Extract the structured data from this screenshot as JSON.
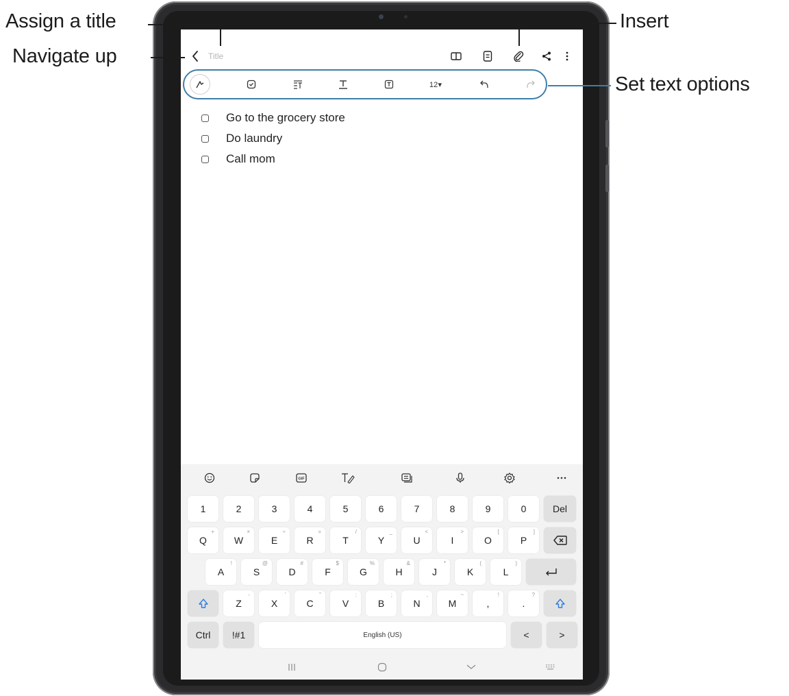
{
  "callouts": {
    "assign_title": "Assign a title",
    "navigate_up": "Navigate up",
    "insert": "Insert",
    "set_text_options": "Set text options"
  },
  "app_bar": {
    "back_icon": "chevron-left-icon",
    "title_placeholder": "Title",
    "actions": [
      {
        "name": "reading-mode",
        "icon": "book-icon"
      },
      {
        "name": "page-view",
        "icon": "document-icon"
      },
      {
        "name": "insert",
        "icon": "paperclip-icon"
      },
      {
        "name": "share",
        "icon": "share-icon"
      },
      {
        "name": "more-options",
        "icon": "more-vertical-icon"
      }
    ]
  },
  "text_toolbar": {
    "items": [
      "pen-icon",
      "checkbox-icon",
      "paragraph-style-icon",
      "text-style-icon",
      "text-box-icon",
      "font-size",
      "undo-icon",
      "redo-icon"
    ],
    "font_size_label": "12▾"
  },
  "note": {
    "checklist": [
      {
        "text": "Go to the grocery store",
        "checked": false
      },
      {
        "text": "Do laundry",
        "checked": false
      },
      {
        "text": "Call mom",
        "checked": false
      }
    ]
  },
  "keyboard": {
    "toolbar": [
      "emoji-icon",
      "sticker-icon",
      "gif-icon",
      "handwriting-icon",
      "clipboard-icon",
      "mic-icon",
      "settings-icon",
      "more-horizontal-icon"
    ],
    "row1": [
      "1",
      "2",
      "3",
      "4",
      "5",
      "6",
      "7",
      "8",
      "9",
      "0",
      "Del"
    ],
    "row2": [
      {
        "key": "Q",
        "sub": "+"
      },
      {
        "key": "W",
        "sub": "×"
      },
      {
        "key": "E",
        "sub": "÷"
      },
      {
        "key": "R",
        "sub": "="
      },
      {
        "key": "T",
        "sub": "/"
      },
      {
        "key": "Y",
        "sub": "_"
      },
      {
        "key": "U",
        "sub": "<"
      },
      {
        "key": "I",
        "sub": ">"
      },
      {
        "key": "O",
        "sub": "["
      },
      {
        "key": "P",
        "sub": "]"
      }
    ],
    "row3": [
      {
        "key": "A",
        "sub": "!"
      },
      {
        "key": "S",
        "sub": "@"
      },
      {
        "key": "D",
        "sub": "#"
      },
      {
        "key": "F",
        "sub": "$"
      },
      {
        "key": "G",
        "sub": "%"
      },
      {
        "key": "H",
        "sub": "&"
      },
      {
        "key": "J",
        "sub": "*"
      },
      {
        "key": "K",
        "sub": "("
      },
      {
        "key": "L",
        "sub": ")"
      }
    ],
    "row4": [
      {
        "key": "Z",
        "sub": "-"
      },
      {
        "key": "X",
        "sub": "'"
      },
      {
        "key": "C",
        "sub": "\""
      },
      {
        "key": "V",
        "sub": ":"
      },
      {
        "key": "B",
        "sub": ";"
      },
      {
        "key": "N",
        "sub": ","
      },
      {
        "key": "M",
        "sub": "~"
      },
      {
        "key": ",",
        "sub": "!"
      },
      {
        "key": ".",
        "sub": "?"
      }
    ],
    "ctrl": "Ctrl",
    "symbols": "!#1",
    "space": "English (US)",
    "left_arrow": "<",
    "right_arrow": ">"
  },
  "accent_color": "#3e7ea8",
  "shift_color": "#2f7de1"
}
